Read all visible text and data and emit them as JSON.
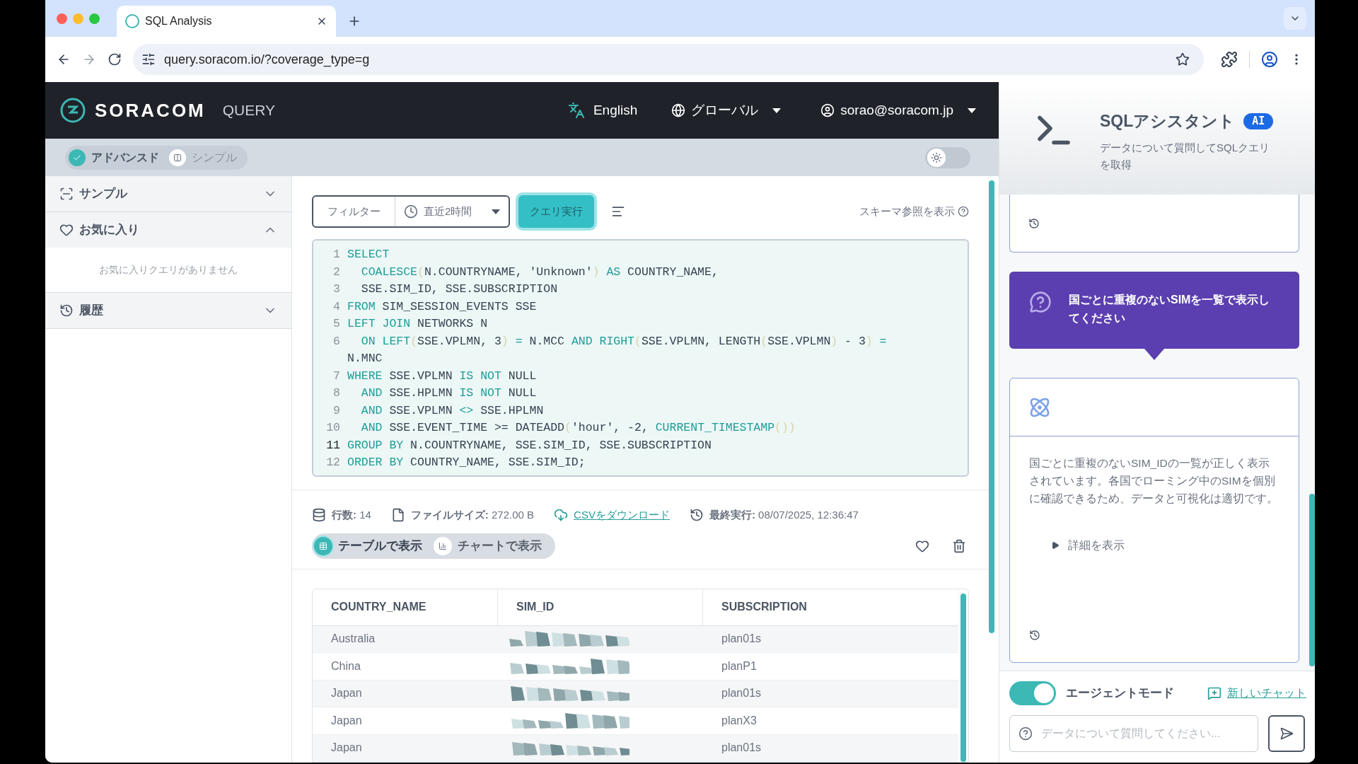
{
  "browser": {
    "tab_title": "SQL Analysis",
    "url": "query.soracom.io/?coverage_type=g"
  },
  "header": {
    "brand": "SORACOM",
    "product": "QUERY",
    "language": "English",
    "region": "グローバル",
    "user": "sorao@soracom.jp"
  },
  "mode_toggle": [
    {
      "label": "アドバンスド",
      "selected": true
    },
    {
      "label": "シンプル",
      "selected": false
    }
  ],
  "theme_switch": {
    "on": false
  },
  "sidebar": {
    "sections": [
      {
        "title": "サンプル",
        "kind": "sample",
        "expanded": false
      },
      {
        "title": "お気に入り",
        "kind": "favorites",
        "expanded": true,
        "empty_text": "お気に入りクエリがありません"
      },
      {
        "title": "履歴",
        "kind": "history",
        "expanded": false
      }
    ]
  },
  "query_toolbar": {
    "filter": "フィルター",
    "time_range": "直近2時間",
    "run": "クエリ実行",
    "schema_link": "スキーマ参照を表示"
  },
  "editor": {
    "lines": [
      {
        "number": "1",
        "active": false,
        "tokens": [
          {
            "kind": "keyword",
            "text": "SELECT"
          }
        ]
      },
      {
        "number": "2",
        "active": false,
        "tokens": [
          {
            "kind": "keyword",
            "text": "  COALESCE"
          },
          {
            "kind": "paren",
            "text": "("
          },
          {
            "kind": "plain",
            "text": "N.COUNTRYNAME, 'Unknown'"
          },
          {
            "kind": "paren",
            "text": ")"
          },
          {
            "kind": "keyword",
            "text": " AS"
          },
          {
            "kind": "plain",
            "text": " COUNTRY_NAME,"
          }
        ]
      },
      {
        "number": "3",
        "active": false,
        "tokens": [
          {
            "kind": "plain",
            "text": "  SSE.SIM_ID, SSE.SUBSCRIPTION"
          }
        ]
      },
      {
        "number": "4",
        "active": false,
        "tokens": [
          {
            "kind": "keyword",
            "text": "FROM"
          },
          {
            "kind": "plain",
            "text": " SIM_SESSION_EVENTS SSE"
          }
        ]
      },
      {
        "number": "5",
        "active": false,
        "tokens": [
          {
            "kind": "keyword",
            "text": "LEFT JOIN"
          },
          {
            "kind": "plain",
            "text": " NETWORKS N"
          }
        ]
      },
      {
        "number": "6",
        "active": false,
        "tokens": [
          {
            "kind": "keyword",
            "text": "  ON LEFT"
          },
          {
            "kind": "paren",
            "text": "("
          },
          {
            "kind": "plain",
            "text": "SSE.VPLMN, 3"
          },
          {
            "kind": "paren",
            "text": ")"
          },
          {
            "kind": "keyword",
            "text": " = "
          },
          {
            "kind": "plain",
            "text": "N.MCC "
          },
          {
            "kind": "keyword",
            "text": "AND RIGHT"
          },
          {
            "kind": "paren",
            "text": "("
          },
          {
            "kind": "plain",
            "text": "SSE.VPLMN, LENGTH"
          },
          {
            "kind": "paren",
            "text": "("
          },
          {
            "kind": "plain",
            "text": "SSE.VPLMN"
          },
          {
            "kind": "paren",
            "text": ")"
          },
          {
            "kind": "plain",
            "text": " - 3"
          },
          {
            "kind": "paren",
            "text": ")"
          },
          {
            "kind": "keyword",
            "text": " = "
          },
          {
            "kind": "plain",
            "text": "N.MNC"
          }
        ]
      },
      {
        "number": "7",
        "active": false,
        "tokens": [
          {
            "kind": "keyword",
            "text": "WHERE"
          },
          {
            "kind": "plain",
            "text": " SSE.VPLMN "
          },
          {
            "kind": "keyword",
            "text": "IS NOT"
          },
          {
            "kind": "plain",
            "text": " NULL"
          }
        ]
      },
      {
        "number": "8",
        "active": false,
        "tokens": [
          {
            "kind": "keyword",
            "text": "  AND"
          },
          {
            "kind": "plain",
            "text": " SSE.HPLMN "
          },
          {
            "kind": "keyword",
            "text": "IS NOT"
          },
          {
            "kind": "plain",
            "text": " NULL"
          }
        ]
      },
      {
        "number": "9",
        "active": false,
        "tokens": [
          {
            "kind": "keyword",
            "text": "  AND"
          },
          {
            "kind": "plain",
            "text": " SSE.VPLMN "
          },
          {
            "kind": "keyword",
            "text": "<>"
          },
          {
            "kind": "plain",
            "text": " SSE.HPLMN"
          }
        ]
      },
      {
        "number": "10",
        "active": false,
        "tokens": [
          {
            "kind": "keyword",
            "text": "  AND"
          },
          {
            "kind": "plain",
            "text": " SSE.EVENT_TIME >= DATEADD"
          },
          {
            "kind": "paren",
            "text": "("
          },
          {
            "kind": "plain",
            "text": "'hour', -2, "
          },
          {
            "kind": "keyword",
            "text": "CURRENT_TIMESTAMP"
          },
          {
            "kind": "paren",
            "text": "())"
          }
        ]
      },
      {
        "number": "11",
        "active": true,
        "tokens": [
          {
            "kind": "keyword",
            "text": "GROUP BY"
          },
          {
            "kind": "plain",
            "text": " N.COUNTRYNAME, SSE.SIM_ID, SSE.SUBSCRIPTION"
          }
        ]
      },
      {
        "number": "12",
        "active": false,
        "tokens": [
          {
            "kind": "keyword",
            "text": "ORDER BY"
          },
          {
            "kind": "plain",
            "text": " COUNTRY_NAME, SSE.SIM_ID;"
          }
        ]
      }
    ]
  },
  "result_meta": [
    {
      "kind": "rows",
      "text": "**行数:** 14"
    },
    {
      "kind": "size",
      "text": "**ファイルサイズ:** 272.00 B"
    },
    {
      "kind": "download",
      "text": "CSVをダウンロード"
    },
    {
      "kind": "last_run",
      "text": "**最終実行:** 08/07/2025, 12:36:47"
    }
  ],
  "view_tabs": [
    {
      "label": "テーブルで表示",
      "kind": "table",
      "selected": true
    },
    {
      "label": "チャートで表示",
      "kind": "chart",
      "selected": false
    }
  ],
  "table": {
    "columns": [
      "COUNTRY_NAME",
      "SIM_ID",
      "SUBSCRIPTION"
    ],
    "rows": [
      {
        "country_name": "Australia",
        "subscription": "plan01s"
      },
      {
        "country_name": "China",
        "subscription": "planP1"
      },
      {
        "country_name": "Japan",
        "subscription": "plan01s"
      },
      {
        "country_name": "Japan",
        "subscription": "planX3"
      },
      {
        "country_name": "Japan",
        "subscription": "plan01s"
      }
    ]
  },
  "assistant": {
    "title": "SQLアシスタント",
    "badge": "AI",
    "subtitle": "データについて質問してSQLクエリを取得",
    "messages": [
      {
        "kind": "reply_end"
      },
      {
        "kind": "user",
        "text": "国ごとに重複のないSIMを一覧で表示してください"
      },
      {
        "kind": "reply",
        "text": "国ごとに重複のないSIM_IDの一覧が正しく表示されています。各国でローミング中のSIMを個別に確認できるため、データと可視化は適切です。",
        "details": "詳細を表示"
      }
    ],
    "agent_mode": {
      "label": "エージェントモード",
      "on": true
    },
    "new_chat": "新しいチャット",
    "input_placeholder": "データについて質問してください..."
  }
}
